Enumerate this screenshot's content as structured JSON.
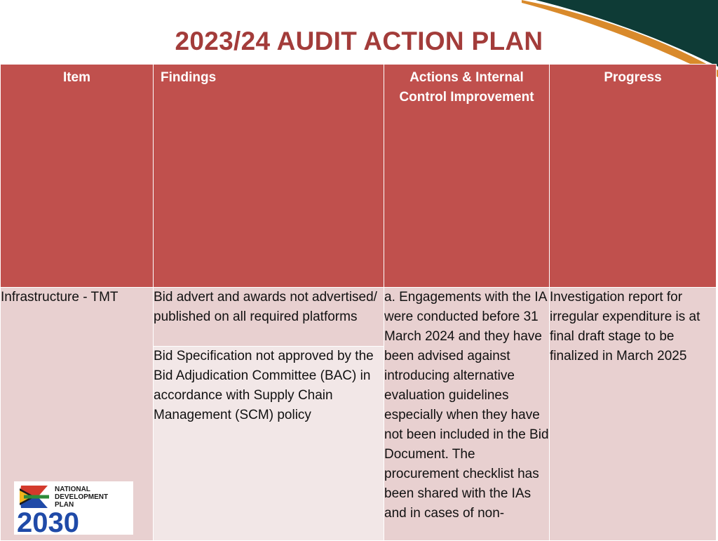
{
  "title": "2023/24 AUDIT ACTION PLAN",
  "table": {
    "headers": [
      "Item",
      "Findings",
      "Actions  & Internal Control Improvement",
      "Progress"
    ],
    "row": {
      "item": "Infrastructure - TMT",
      "findings": [
        " Bid advert and awards not advertised/ published on all required platforms",
        "Bid Specification not approved by the Bid Adjudication Committee (BAC) in accordance with Supply Chain Management (SCM) policy"
      ],
      "actions": " a. Engagements with the IA were conducted before 31 March 2024 and they have been advised against introducing alternative evaluation guidelines especially when they have not been included in the Bid Document. The procurement checklist has been shared with the IAs and in cases of non-",
      "progress": "Investigation report for irregular expenditure is at final draft stage to be finalized in March 2025"
    }
  },
  "logo": {
    "line1": "NATIONAL",
    "line2": "DEVELOPMENT",
    "line3": "PLAN",
    "year": "2030"
  },
  "colors": {
    "title": "#a33c3a",
    "header_bg": "#c0504d",
    "cell_pink": "#e8d0d0",
    "cell_light": "#f2e7e7",
    "swoosh_dark": "#0e3b36",
    "swoosh_orange": "#d98a2b"
  }
}
